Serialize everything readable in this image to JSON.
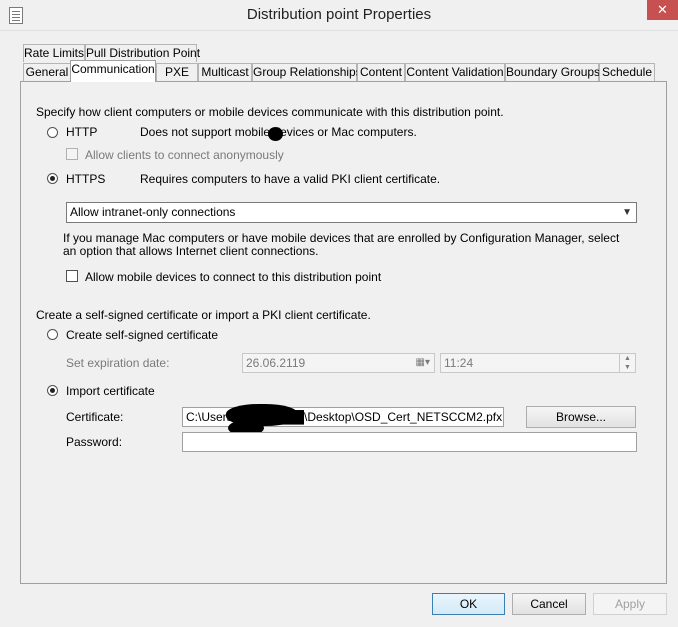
{
  "window": {
    "title": "Distribution point Properties",
    "close": "✕"
  },
  "tabs_row1": [
    "Rate Limits",
    "Pull Distribution Point"
  ],
  "tabs_row2": [
    "General",
    "Communication",
    "PXE",
    "Multicast",
    "Group Relationships",
    "Content",
    "Content Validation",
    "Boundary Groups",
    "Schedule"
  ],
  "communication": {
    "intro": "Specify how client computers or mobile devices communicate with this distribution point.",
    "http": {
      "label": "HTTP",
      "desc": "Does not support mobile devices or Mac computers.",
      "selected": false
    },
    "allow_anonymous": {
      "label": "Allow clients to connect anonymously",
      "checked": false,
      "enabled": false
    },
    "https": {
      "label": "HTTPS",
      "desc": "Requires computers to have a valid PKI client certificate.",
      "selected": true
    },
    "connection_select": {
      "value": "Allow intranet-only connections"
    },
    "mac_note": "If you manage Mac computers or have mobile devices that are enrolled by Configuration Manager, select an option that allows Internet client connections.",
    "allow_mobile": {
      "label": "Allow mobile devices to connect to this distribution point",
      "checked": false
    }
  },
  "certificate": {
    "intro": "Create a self-signed certificate or import a PKI client certificate.",
    "self_signed": {
      "label": "Create self-signed certificate",
      "selected": false
    },
    "expiration_label": "Set expiration date:",
    "expiration_date": "26.06.2119",
    "expiration_time": "11:24",
    "import": {
      "label": "Import certificate",
      "selected": true
    },
    "certificate_label": "Certificate:",
    "certificate_path": "C:\\Users\\████████\\Desktop\\OSD_Cert_NETSCCM2.pfx",
    "browse_label": "Browse...",
    "password_label": "Password:",
    "password_value": ""
  },
  "footer": {
    "ok": "OK",
    "cancel": "Cancel",
    "apply": "Apply"
  },
  "colors": {
    "close_button": "#c75050",
    "default_button_border": "#3c7fb1"
  }
}
